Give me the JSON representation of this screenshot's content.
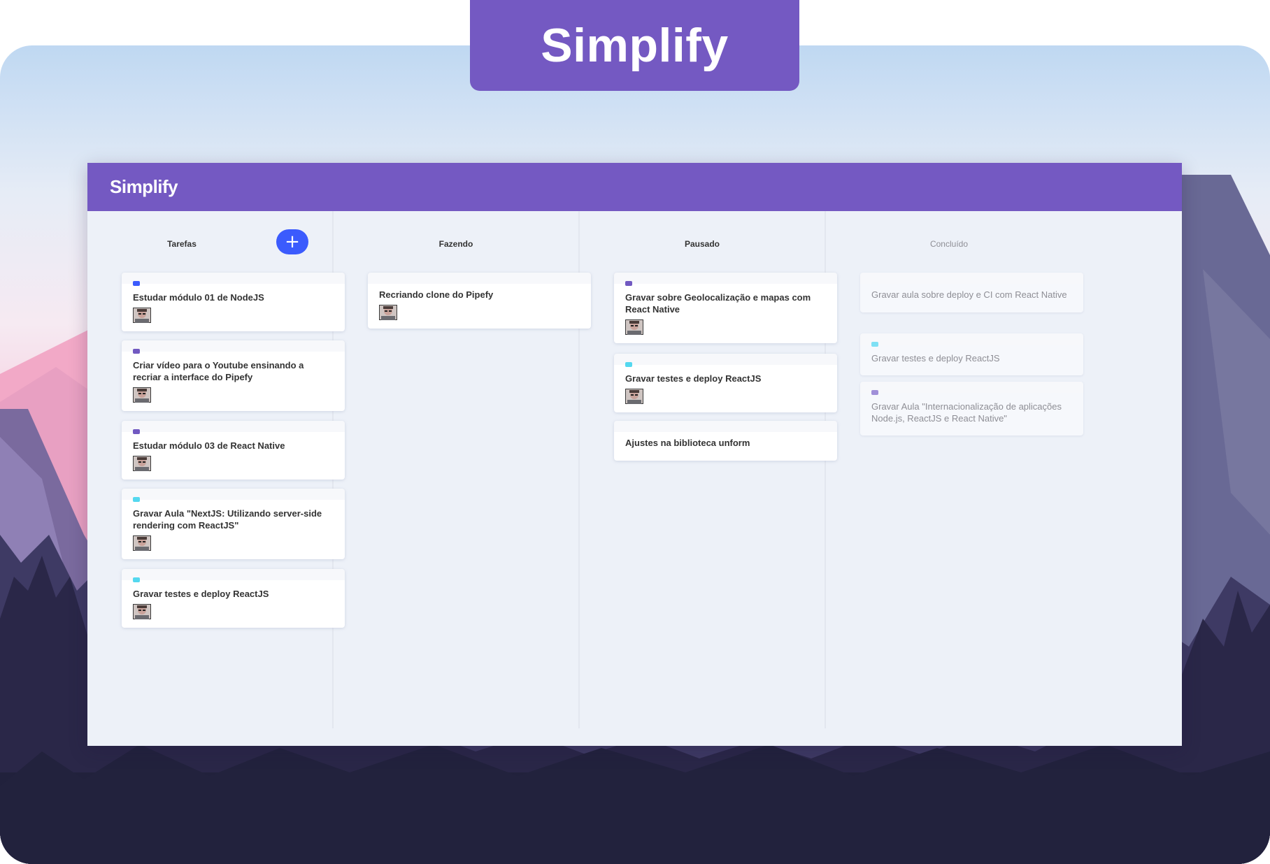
{
  "banner": {
    "title": "Simplify"
  },
  "app": {
    "logo": "Simplify"
  },
  "colors": {
    "brand_purple": "#7459c2",
    "add_button_blue": "#3b5bfd",
    "label_blue": "#3b5bfd",
    "label_purple": "#7159c1",
    "label_cyan": "#54d8ef",
    "label_lavender": "#a08fd8"
  },
  "icons": {
    "add": "plus-icon",
    "avatar": "user-avatar"
  },
  "lists": [
    {
      "title": "Tarefas",
      "add_button_label": "+",
      "cards": [
        {
          "label_color": "#3b5bfd",
          "content": "Estudar módulo 01 de NodeJS",
          "has_avatar": true
        },
        {
          "label_color": "#7159c1",
          "content": "Criar vídeo para o Youtube ensinando a recriar a interface do Pipefy",
          "has_avatar": true
        },
        {
          "label_color": "#7159c1",
          "content": "Estudar módulo 03 de React Native",
          "has_avatar": true
        },
        {
          "label_color": "#54d8ef",
          "content": "Gravar Aula \"NextJS: Utilizando server-side rendering com ReactJS\"",
          "has_avatar": true
        },
        {
          "label_color": "#54d8ef",
          "content": "Gravar testes e deploy ReactJS",
          "has_avatar": true
        }
      ]
    },
    {
      "title": "Fazendo",
      "cards": [
        {
          "label_color": null,
          "content": "Recriando clone do Pipefy",
          "has_avatar": true
        }
      ]
    },
    {
      "title": "Pausado",
      "cards": [
        {
          "label_color": "#7159c1",
          "content": "Gravar sobre Geolocalização e mapas com React Native",
          "has_avatar": true
        },
        {
          "label_color": "#54d8ef",
          "content": "Gravar testes e deploy ReactJS",
          "has_avatar": true
        },
        {
          "label_color": null,
          "content": "Ajustes na biblioteca unform",
          "has_avatar": false
        }
      ]
    },
    {
      "title": "Concluído",
      "done": true,
      "cards": [
        {
          "label_color": null,
          "content": "Gravar aula sobre deploy e CI com React Native",
          "has_avatar": false
        },
        {
          "label_color": "#7ee0f4",
          "content": "Gravar testes e deploy ReactJS",
          "has_avatar": false
        },
        {
          "label_color": "#a08fd8",
          "content": "Gravar Aula \"Internacionalização de aplicações Node.js, ReactJS e React Native\"",
          "has_avatar": false
        }
      ]
    }
  ]
}
